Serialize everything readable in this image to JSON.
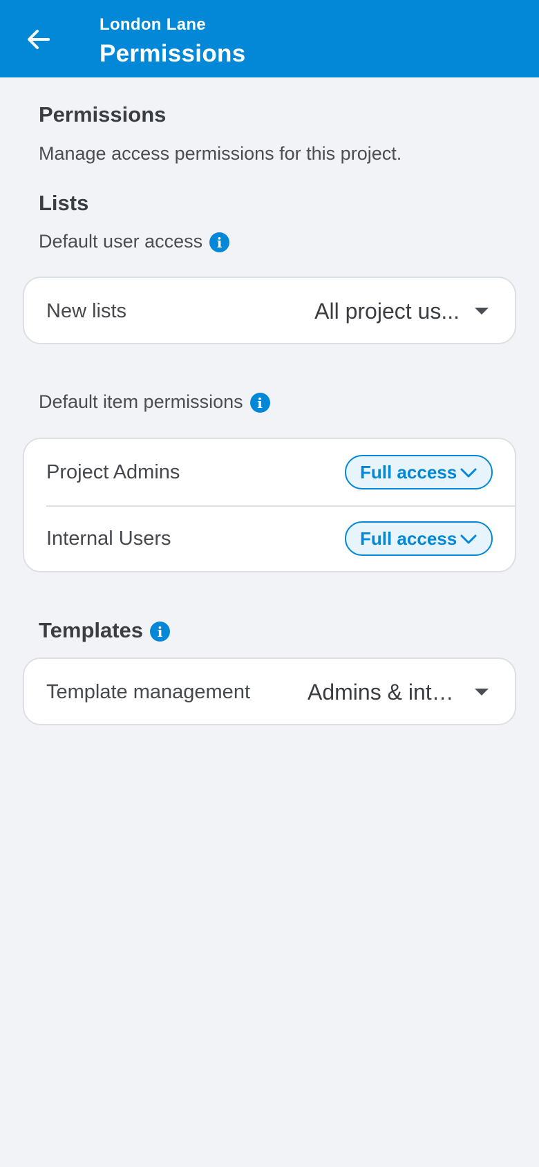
{
  "appbar": {
    "subtitle": "London Lane",
    "title": "Permissions"
  },
  "intro": {
    "heading": "Permissions",
    "description": "Manage access permissions for this project."
  },
  "lists": {
    "heading": "Lists",
    "default_user_access_label": "Default user access",
    "new_lists": {
      "label": "New lists",
      "value": "All project us..."
    },
    "default_item_permissions_label": "Default item permissions",
    "item_permissions": [
      {
        "label": "Project Admins",
        "value": "Full access"
      },
      {
        "label": "Internal Users",
        "value": "Full access"
      }
    ]
  },
  "templates": {
    "heading": "Templates",
    "management": {
      "label": "Template management",
      "value": "Admins & inte..."
    }
  },
  "icons": {
    "back": "arrow-left-icon",
    "info": "info-icon",
    "dropdown": "caret-down-icon",
    "pill_chevron": "chevron-down-icon"
  },
  "colors": {
    "primary": "#0288d6",
    "background": "#f1f3f7",
    "card": "#ffffff"
  }
}
